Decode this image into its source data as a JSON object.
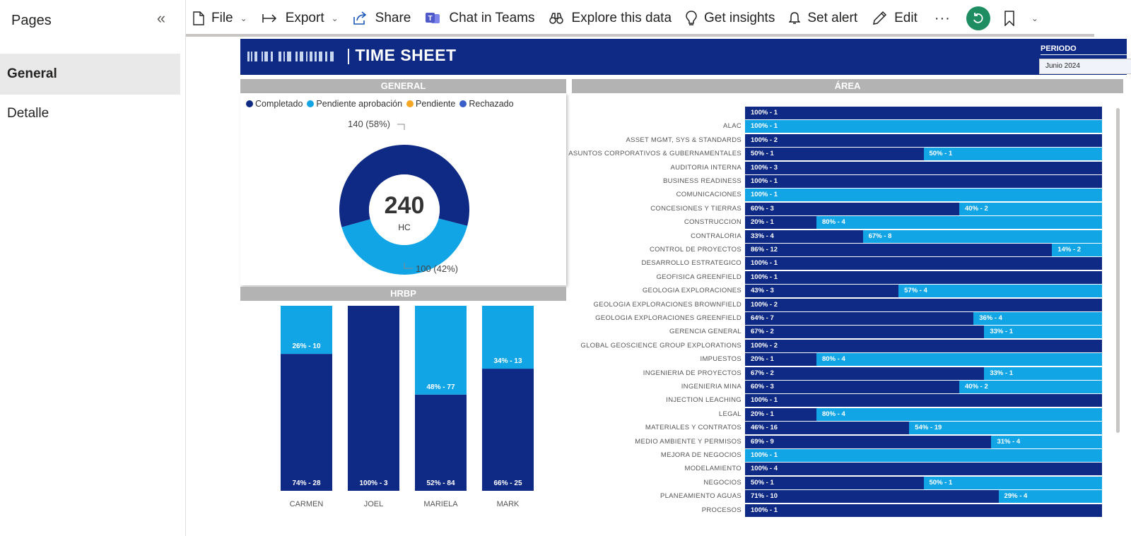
{
  "pages_pane": {
    "title": "Pages",
    "items": [
      {
        "label": "General",
        "active": true
      },
      {
        "label": "Detalle",
        "active": false
      }
    ]
  },
  "toolbar": {
    "file": "File",
    "export": "Export",
    "share": "Share",
    "chat_in_teams": "Chat in Teams",
    "explore": "Explore this data",
    "insights": "Get insights",
    "alert": "Set alert",
    "edit": "Edit",
    "more": "···"
  },
  "banner": {
    "title": "TIME SHEET",
    "periodo_label": "PERIODO",
    "periodo_value": "Junio 2024"
  },
  "colors": {
    "completado": "#0f2a85",
    "pendiente_aprobacion": "#12a5e6",
    "pendiente": "#f5a623",
    "rechazado": "#3a5fc8"
  },
  "general": {
    "header": "GENERAL",
    "legend": [
      "Completado",
      "Pendiente aprobación",
      "Pendiente",
      "Rechazado"
    ],
    "center_value": "240",
    "center_label": "HC",
    "label_completado": "140 (58%)",
    "label_pendiente": "100 (42%)"
  },
  "hrbp": {
    "header": "HRBP"
  },
  "area": {
    "header": "ÁREA"
  },
  "chart_data": [
    {
      "type": "pie",
      "title": "GENERAL",
      "categories": [
        "Completado",
        "Pendiente aprobación"
      ],
      "values": [
        140,
        100
      ],
      "percent": [
        58,
        42
      ],
      "total": 240,
      "legend": [
        "Completado",
        "Pendiente aprobación",
        "Pendiente",
        "Rechazado"
      ]
    },
    {
      "type": "bar",
      "title": "HRBP",
      "categories": [
        "CARMEN",
        "JOEL",
        "MARIELA",
        "MARK"
      ],
      "series": [
        {
          "name": "Completado",
          "values": [
            28,
            3,
            84,
            25
          ],
          "percent": [
            74,
            100,
            52,
            66
          ],
          "labels": [
            "74% - 28",
            "100% - 3",
            "52% - 84",
            "66% - 25"
          ]
        },
        {
          "name": "Pendiente aprobación",
          "values": [
            10,
            0,
            77,
            13
          ],
          "percent": [
            26,
            0,
            48,
            34
          ],
          "labels": [
            "26% - 10",
            "",
            "48% - 77",
            "34% - 13"
          ]
        }
      ]
    },
    {
      "type": "bar",
      "title": "ÁREA",
      "rows": [
        {
          "label": "",
          "segments": [
            {
              "pct": 100,
              "text": "100% - 1",
              "status": "completado"
            }
          ]
        },
        {
          "label": "ALAC",
          "segments": [
            {
              "pct": 100,
              "text": "100% - 1",
              "status": "pendiente_aprobacion"
            }
          ]
        },
        {
          "label": "ASSET MGMT, SYS & STANDARDS",
          "segments": [
            {
              "pct": 100,
              "text": "100% - 2",
              "status": "completado"
            }
          ]
        },
        {
          "label": "ASUNTOS CORPORATIVOS & GUBERNAMENTALES",
          "segments": [
            {
              "pct": 50,
              "text": "50% - 1",
              "status": "completado"
            },
            {
              "pct": 50,
              "text": "50% - 1",
              "status": "pendiente_aprobacion"
            }
          ]
        },
        {
          "label": "AUDITORIA INTERNA",
          "segments": [
            {
              "pct": 100,
              "text": "100% - 3",
              "status": "completado"
            }
          ]
        },
        {
          "label": "BUSINESS READINESS",
          "segments": [
            {
              "pct": 100,
              "text": "100% - 1",
              "status": "completado"
            }
          ]
        },
        {
          "label": "COMUNICACIONES",
          "segments": [
            {
              "pct": 100,
              "text": "100% - 1",
              "status": "pendiente_aprobacion"
            }
          ]
        },
        {
          "label": "CONCESIONES Y TIERRAS",
          "segments": [
            {
              "pct": 60,
              "text": "60% - 3",
              "status": "completado"
            },
            {
              "pct": 40,
              "text": "40% - 2",
              "status": "pendiente_aprobacion"
            }
          ]
        },
        {
          "label": "CONSTRUCCION",
          "segments": [
            {
              "pct": 20,
              "text": "20% - 1",
              "status": "completado"
            },
            {
              "pct": 80,
              "text": "80% - 4",
              "status": "pendiente_aprobacion"
            }
          ]
        },
        {
          "label": "CONTRALORIA",
          "segments": [
            {
              "pct": 33,
              "text": "33% - 4",
              "status": "completado"
            },
            {
              "pct": 67,
              "text": "67% - 8",
              "status": "pendiente_aprobacion"
            }
          ]
        },
        {
          "label": "CONTROL DE PROYECTOS",
          "segments": [
            {
              "pct": 86,
              "text": "86% - 12",
              "status": "completado"
            },
            {
              "pct": 14,
              "text": "14% - 2",
              "status": "pendiente_aprobacion"
            }
          ]
        },
        {
          "label": "DESARROLLO ESTRATEGICO",
          "segments": [
            {
              "pct": 100,
              "text": "100% - 1",
              "status": "completado"
            }
          ]
        },
        {
          "label": "GEOFISICA GREENFIELD",
          "segments": [
            {
              "pct": 100,
              "text": "100% - 1",
              "status": "completado"
            }
          ]
        },
        {
          "label": "GEOLOGIA EXPLORACIONES",
          "segments": [
            {
              "pct": 43,
              "text": "43% - 3",
              "status": "completado"
            },
            {
              "pct": 57,
              "text": "57% - 4",
              "status": "pendiente_aprobacion"
            }
          ]
        },
        {
          "label": "GEOLOGIA EXPLORACIONES BROWNFIELD",
          "segments": [
            {
              "pct": 100,
              "text": "100% - 2",
              "status": "completado"
            }
          ]
        },
        {
          "label": "GEOLOGIA EXPLORACIONES GREENFIELD",
          "segments": [
            {
              "pct": 64,
              "text": "64% - 7",
              "status": "completado"
            },
            {
              "pct": 36,
              "text": "36% - 4",
              "status": "pendiente_aprobacion"
            }
          ]
        },
        {
          "label": "GERENCIA GENERAL",
          "segments": [
            {
              "pct": 67,
              "text": "67% - 2",
              "status": "completado"
            },
            {
              "pct": 33,
              "text": "33% - 1",
              "status": "pendiente_aprobacion"
            }
          ]
        },
        {
          "label": "GLOBAL GEOSCIENCE GROUP EXPLORATIONS",
          "segments": [
            {
              "pct": 100,
              "text": "100% - 2",
              "status": "completado"
            }
          ]
        },
        {
          "label": "IMPUESTOS",
          "segments": [
            {
              "pct": 20,
              "text": "20% - 1",
              "status": "completado"
            },
            {
              "pct": 80,
              "text": "80% - 4",
              "status": "pendiente_aprobacion"
            }
          ]
        },
        {
          "label": "INGENIERIA DE PROYECTOS",
          "segments": [
            {
              "pct": 67,
              "text": "67% - 2",
              "status": "completado"
            },
            {
              "pct": 33,
              "text": "33% - 1",
              "status": "pendiente_aprobacion"
            }
          ]
        },
        {
          "label": "INGENIERIA MINA",
          "segments": [
            {
              "pct": 60,
              "text": "60% - 3",
              "status": "completado"
            },
            {
              "pct": 40,
              "text": "40% - 2",
              "status": "pendiente_aprobacion"
            }
          ]
        },
        {
          "label": "INJECTION LEACHING",
          "segments": [
            {
              "pct": 100,
              "text": "100% - 1",
              "status": "completado"
            }
          ]
        },
        {
          "label": "LEGAL",
          "segments": [
            {
              "pct": 20,
              "text": "20% - 1",
              "status": "completado"
            },
            {
              "pct": 80,
              "text": "80% - 4",
              "status": "pendiente_aprobacion"
            }
          ]
        },
        {
          "label": "MATERIALES Y CONTRATOS",
          "segments": [
            {
              "pct": 46,
              "text": "46% - 16",
              "status": "completado"
            },
            {
              "pct": 54,
              "text": "54% - 19",
              "status": "pendiente_aprobacion"
            }
          ]
        },
        {
          "label": "MEDIO AMBIENTE Y PERMISOS",
          "segments": [
            {
              "pct": 69,
              "text": "69% - 9",
              "status": "completado"
            },
            {
              "pct": 31,
              "text": "31% - 4",
              "status": "pendiente_aprobacion"
            }
          ]
        },
        {
          "label": "MEJORA DE NEGOCIOS",
          "segments": [
            {
              "pct": 100,
              "text": "100% - 1",
              "status": "pendiente_aprobacion"
            }
          ]
        },
        {
          "label": "MODELAMIENTO",
          "segments": [
            {
              "pct": 100,
              "text": "100% - 4",
              "status": "completado"
            }
          ]
        },
        {
          "label": "NEGOCIOS",
          "segments": [
            {
              "pct": 50,
              "text": "50% - 1",
              "status": "completado"
            },
            {
              "pct": 50,
              "text": "50% - 1",
              "status": "pendiente_aprobacion"
            }
          ]
        },
        {
          "label": "PLANEAMIENTO AGUAS",
          "segments": [
            {
              "pct": 71,
              "text": "71% - 10",
              "status": "completado"
            },
            {
              "pct": 29,
              "text": "29% - 4",
              "status": "pendiente_aprobacion"
            }
          ]
        },
        {
          "label": "PROCESOS",
          "segments": [
            {
              "pct": 100,
              "text": "100% - 1",
              "status": "completado"
            }
          ]
        }
      ]
    }
  ]
}
